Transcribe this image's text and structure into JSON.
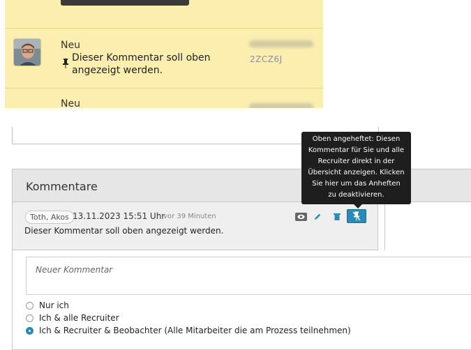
{
  "entries": [
    {
      "title": "Neu",
      "text": "Dieser Kommentar soll oben angezeigt werden.",
      "code": "2ZCZ6J"
    },
    {
      "title": "Neu"
    }
  ],
  "comments_panel": {
    "title": "Kommentare",
    "comment": {
      "author": "Toth, Akos",
      "datetime": "13.11.2023 15:51 Uhr",
      "ago": "vor 39 Minuten",
      "text": "Dieser Kommentar soll oben angezeigt werden."
    },
    "new_comment_placeholder": "Neuer Kommentar",
    "visibility_options": [
      {
        "label": "Nur ich",
        "checked": false
      },
      {
        "label": "Ich & alle Recruiter",
        "checked": false
      },
      {
        "label": "Ich & Recruiter & Beobachter (Alle Mitarbeiter die am Prozess teilnehmen)",
        "checked": true
      }
    ]
  },
  "tooltip": {
    "text": "Oben angeheftet: Diesen Kommentar für Sie und alle Recruiter direkt in der Übersicht anzeigen. Klicken Sie hier um das Anheften zu deaktivieren."
  },
  "colors": {
    "highlight_bg": "#fbeeaf",
    "accent": "#2b8bb6",
    "tooltip_bg": "#1e1e1e"
  },
  "icons": [
    "pin-icon",
    "eye-icon",
    "pencil-icon",
    "trash-icon",
    "unpin-icon"
  ]
}
